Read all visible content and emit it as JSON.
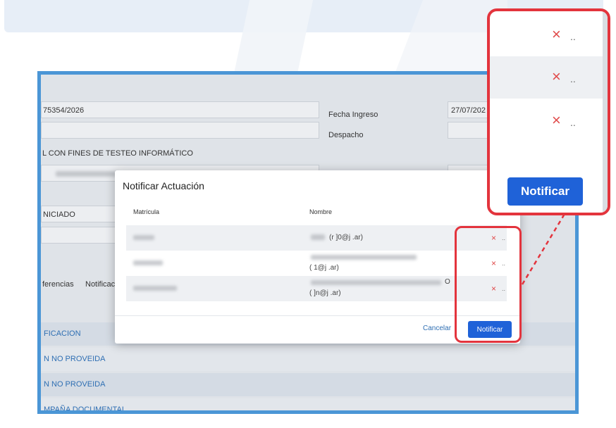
{
  "form": {
    "expediente": "75354/2026",
    "fecha_ingreso_label": "Fecha Ingreso",
    "fecha_ingreso_value": "27/07/202",
    "despacho_label": "Despacho",
    "caratula": "L CON FINES DE TESTEO INFORMÁTICO",
    "estado": "NICIADO",
    "tab_transferencias": "ferencias",
    "tab_notificaciones": "Notificac"
  },
  "table_rows": [
    {
      "label": "FICACION"
    },
    {
      "label": "N NO PROVEIDA"
    },
    {
      "label": "N NO PROVEIDA"
    },
    {
      "label": "MPAÑA DOCUMENTAL"
    }
  ],
  "modal": {
    "title": "Notificar Actuación",
    "col_matricula": "Matrícula",
    "col_nombre": "Nombre",
    "rows": [
      {
        "nombre_line1": "(r   ]0@j                    .ar)",
        "nombre_line2": ""
      },
      {
        "nombre_line1": "",
        "nombre_line2": "(           1@j                   .ar)"
      },
      {
        "nombre_line1": "O",
        "nombre_line2": "(           ]n@j                   .ar)"
      }
    ],
    "remove_symbol": "×",
    "more_symbol": "..",
    "cancel_label": "Cancelar",
    "submit_label": "Notificar"
  },
  "zoom": {
    "submit_label": "Notificar"
  },
  "colors": {
    "accent": "#1f62d8",
    "highlight": "#e3343d",
    "frame": "#4b96d6",
    "remove": "#e04a4a"
  }
}
